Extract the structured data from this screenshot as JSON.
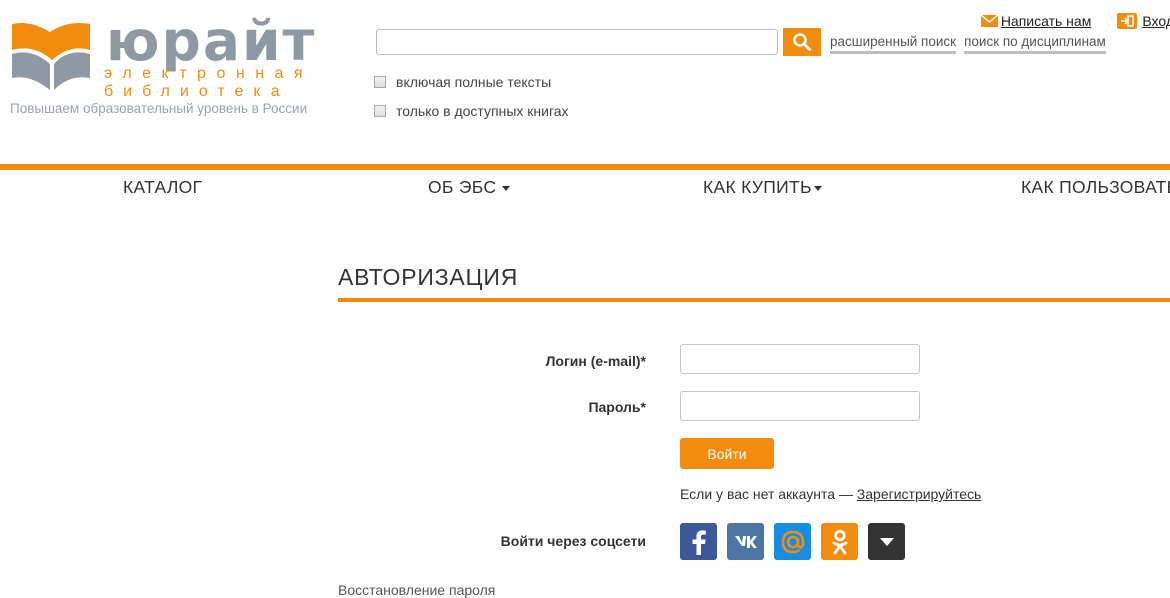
{
  "brand": {
    "name": "юрайт",
    "subtitle_line1": "электронная",
    "subtitle_line2": "библиотека",
    "tagline": "Повышаем образовательный уровень в России",
    "accent_color": "#f28c0f",
    "logo_gray": "#8f99a3"
  },
  "search": {
    "value": "",
    "placeholder": "",
    "button_icon": "magnifier-icon",
    "links": [
      "расширенный поиск",
      "поиск по дисциплинам"
    ],
    "options": [
      {
        "label": "включая полные тексты",
        "checked": false
      },
      {
        "label": "только в доступных книгах",
        "checked": false
      }
    ]
  },
  "header_actions": {
    "write_us": "Написать нам",
    "write_us_icon": "envelope-icon",
    "login": "Вход",
    "login_icon": "sign-in-icon"
  },
  "nav": {
    "items": [
      {
        "label": "КАТАЛОГ",
        "dropdown": false
      },
      {
        "label": "ОБ ЭБС",
        "dropdown": true
      },
      {
        "label": "КАК КУПИТЬ",
        "dropdown": true
      },
      {
        "label": "КАК ПОЛЬЗОВАТЬСЯ",
        "dropdown": false
      }
    ]
  },
  "auth": {
    "title": "АВТОРИЗАЦИЯ",
    "login_label": "Логин (e-mail)*",
    "login_value": "",
    "password_label": "Пароль*",
    "password_value": "",
    "submit_label": "Войти",
    "no_account_text": "Если у вас нет аккаунта — ",
    "register_link": "Зарегистрируйтесь",
    "social_label": "Войти через соцсети",
    "social": [
      {
        "name": "facebook",
        "icon": "facebook-icon",
        "color": "#3b5998"
      },
      {
        "name": "vkontakte",
        "icon": "vk-icon",
        "color": "#4c75a3"
      },
      {
        "name": "mailru",
        "icon": "mailru-icon",
        "color": "#168de2"
      },
      {
        "name": "odnoklassniki",
        "icon": "ok-icon",
        "color": "#f28c0f"
      },
      {
        "name": "more",
        "icon": "chevron-down-icon",
        "color": "#333333"
      }
    ],
    "recover_link": "Восстановление пароля"
  }
}
